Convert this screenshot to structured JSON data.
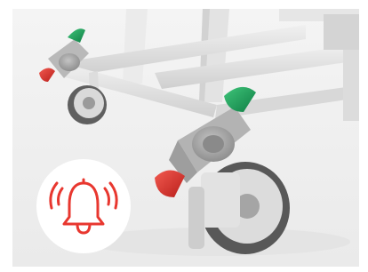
{
  "image": {
    "subject": "trolley-caster-wheels",
    "colors": {
      "background": "#f1f1f1",
      "frame_light": "#e4e4e4",
      "frame_shadow": "#c9c9c9",
      "housing": "#a8a8a8",
      "wheel_rim": "#d9d9d9",
      "tyre": "#5a5a5a",
      "brake_green": "#1fa05a",
      "brake_red": "#e0322f",
      "alert_red": "#e8372f",
      "badge_bg": "#ffffff"
    }
  },
  "badge": {
    "icon": "alarm-bell-icon",
    "shape": "circle"
  }
}
